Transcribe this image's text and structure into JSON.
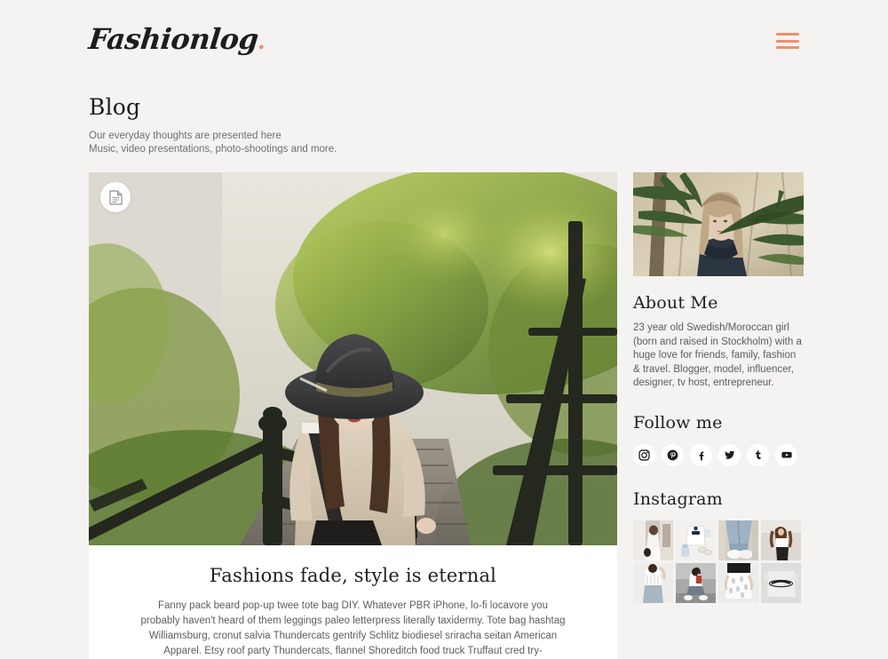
{
  "header": {
    "logo_text": "Fashionlog",
    "logo_dot": ".",
    "menu_icon": "hamburger-menu-icon",
    "accent_color": "#ef8f70"
  },
  "page": {
    "title": "Blog",
    "subtitle_line1": "Our everyday thoughts are presented here",
    "subtitle_line2": "Music, video presentations, photo-shootings and more."
  },
  "post": {
    "badge_icon": "article-document-icon",
    "title": "Fashions fade, style is eternal",
    "excerpt": "Fanny pack beard pop-up twee tote bag DIY. Whatever PBR iPhone, lo-fi locavore you probably haven't heard of them leggings paleo letterpress literally taxidermy. Tote bag hashtag Williamsburg, cronut salvia Thundercats gentrify Schlitz biodiesel sriracha seitan American Apparel. Etsy roof party Thundercats, flannel Shoreditch food truck Truffaut cred try-",
    "hero_alt": "Woman in wide-brim hat walking down wooden stairs"
  },
  "sidebar": {
    "photo_alt": "Portrait of woman among bamboo leaves",
    "about": {
      "title": "About Me",
      "text": "23 year old Swedish/Moroccan girl (born and raised in Stockholm) with a huge love for friends, family, fashion & travel. Blogger, model, influencer, designer, tv host, entrepreneur."
    },
    "follow": {
      "title": "Follow me",
      "socials": [
        {
          "name": "instagram",
          "icon": "instagram-icon"
        },
        {
          "name": "pinterest",
          "icon": "pinterest-icon"
        },
        {
          "name": "facebook",
          "icon": "facebook-icon"
        },
        {
          "name": "twitter",
          "icon": "twitter-icon"
        },
        {
          "name": "tumblr",
          "icon": "tumblr-icon"
        },
        {
          "name": "youtube",
          "icon": "youtube-icon"
        }
      ]
    },
    "instagram": {
      "title": "Instagram",
      "thumbs": [
        {
          "alt": "Woman in white dress on street"
        },
        {
          "alt": "Flatlay of white tee, perfume and sunglasses"
        },
        {
          "alt": "Cropped jeans and white sneakers"
        },
        {
          "alt": "Woman in white top and black pants"
        },
        {
          "alt": "Woman in white crop top and jeans"
        },
        {
          "alt": "Woman seated on pavement in white tee"
        },
        {
          "alt": "White patterned shorts detail"
        },
        {
          "alt": "Grey Champion sweatshirt"
        }
      ]
    }
  }
}
